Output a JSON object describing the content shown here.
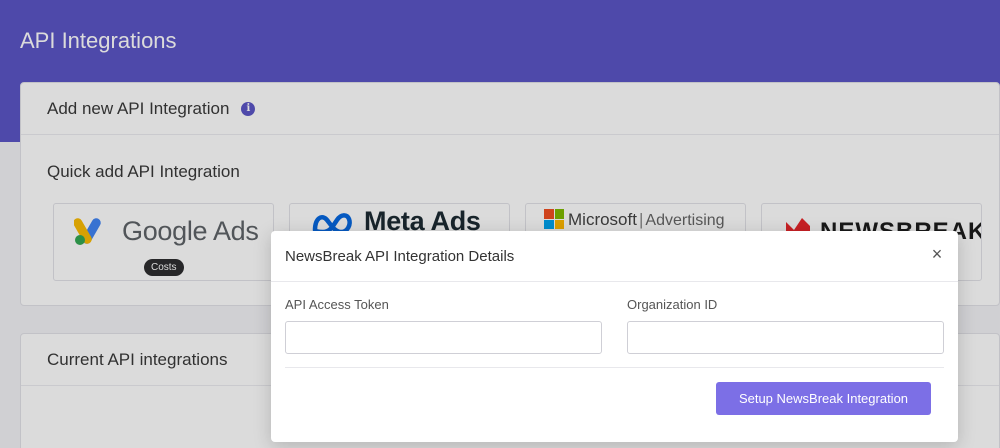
{
  "page": {
    "title": "API Integrations"
  },
  "add_card": {
    "title": "Add new API Integration",
    "info_icon": "info-icon",
    "quick_add_title": "Quick add API Integration",
    "tiles": [
      {
        "name": "Google Ads",
        "badge": "Costs"
      },
      {
        "name": "Meta Ads"
      },
      {
        "name": "Microsoft",
        "suffix": "Advertising"
      },
      {
        "name": "NEWSBREAK"
      }
    ]
  },
  "current_card": {
    "title": "Current API integrations"
  },
  "modal": {
    "title": "NewsBreak API Integration Details",
    "close_icon": "close-icon",
    "token_label": "API Access Token",
    "token_value": "",
    "org_label": "Organization ID",
    "org_value": "",
    "setup_button": "Setup NewsBreak Integration"
  },
  "colors": {
    "header_band": "#5b55c6",
    "accent_button": "#7c6fe6",
    "google_blue": "#4285f4",
    "google_green": "#34a853",
    "google_yellow": "#fbbc04",
    "meta_blue": "#0668e1",
    "ms_red": "#f25022",
    "ms_green": "#7fba00",
    "ms_blue": "#00a4ef",
    "ms_yellow": "#ffb900",
    "newsbreak_red": "#e8262a"
  }
}
